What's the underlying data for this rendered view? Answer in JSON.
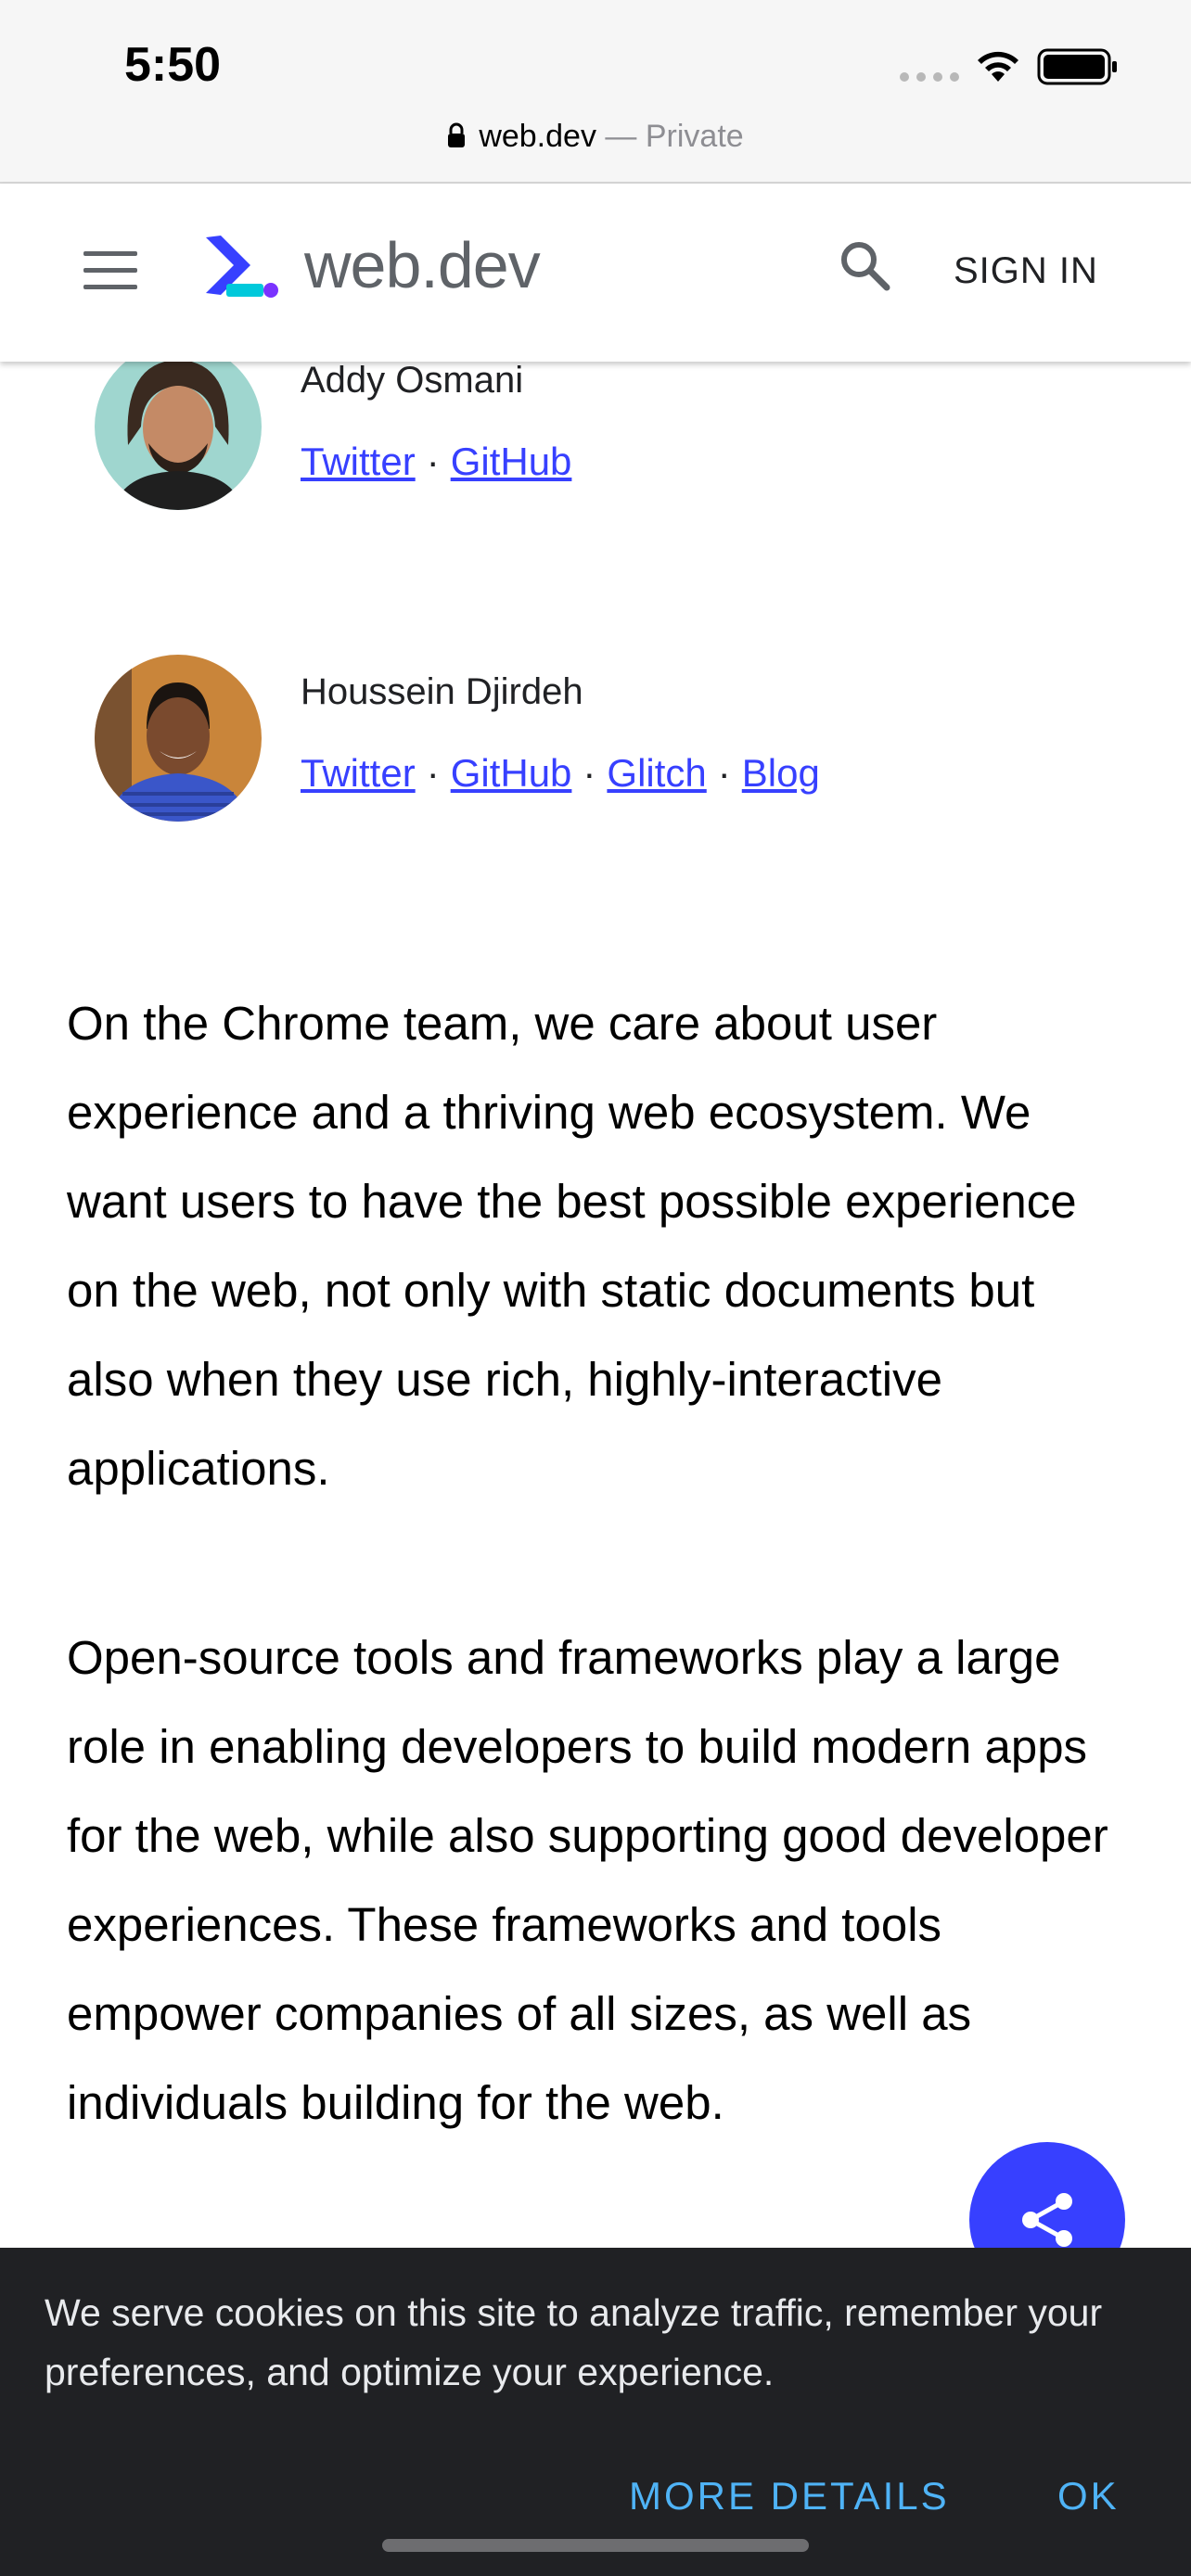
{
  "status_bar": {
    "time": "5:50"
  },
  "url_bar": {
    "domain": "web.dev",
    "separator": " — ",
    "mode": "Private"
  },
  "header": {
    "logo_text": "web.dev",
    "sign_in_label": "SIGN IN",
    "colors": {
      "logo_blue": "#3740ff",
      "logo_teal": "#00c9db",
      "logo_purple": "#7a33ff"
    }
  },
  "authors": [
    {
      "name": "Addy Osmani",
      "links": [
        "Twitter",
        "GitHub"
      ]
    },
    {
      "name": "Houssein Djirdeh",
      "links": [
        "Twitter",
        "GitHub",
        "Glitch",
        "Blog"
      ]
    }
  ],
  "link_separator": "·",
  "article": {
    "paragraphs": [
      "On the Chrome team, we care about user experience and a thriving web ecosystem. We want users to have the best possible experience on the web, not only with static documents but also when they use rich, highly-interactive applications.",
      "Open-source tools and frameworks play a large role in enabling developers to build modern apps for the web, while also supporting good developer experiences. These frameworks and tools empower companies of all sizes, as well as individuals building for the web."
    ]
  },
  "share_button": {
    "icon": "share-icon",
    "color": "#3740ff"
  },
  "cookie_banner": {
    "text": "We serve cookies on this site to analyze traffic, remember your preferences, and optimize your experience.",
    "more_details_label": "MORE DETAILS",
    "ok_label": "OK",
    "accent": "#4fb3f6"
  }
}
